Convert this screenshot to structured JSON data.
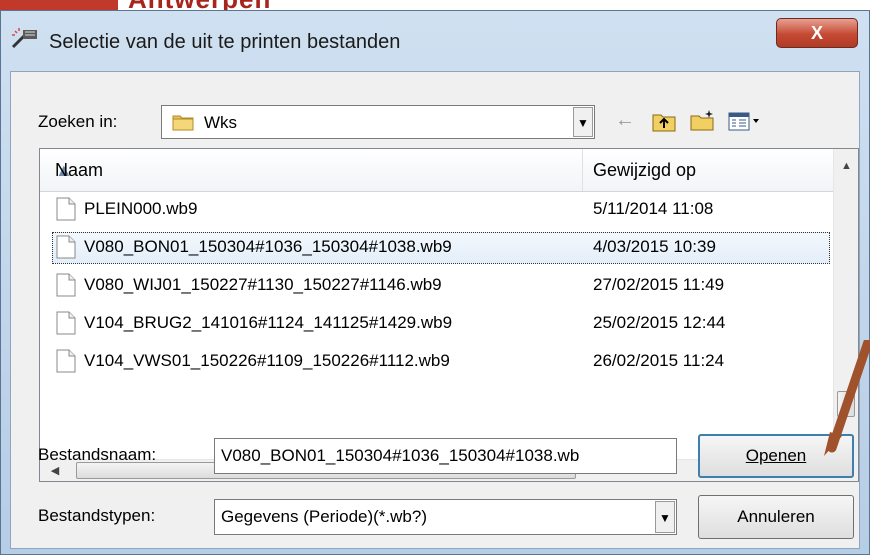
{
  "background_heading": "Antwerpen",
  "dialog": {
    "title": "Selectie van de uit te printen bestanden",
    "close_label": "X"
  },
  "lookin": {
    "label": "Zoeken in:",
    "value": "Wks"
  },
  "columns": {
    "name": "Naam",
    "date": "Gewijzigd op"
  },
  "files": [
    {
      "name": "PLEIN000.wb9",
      "date": "5/11/2014 11:08"
    },
    {
      "name": "V080_BON01_150304#1036_150304#1038.wb9",
      "date": "4/03/2015 10:39",
      "selected": true
    },
    {
      "name": "V080_WIJ01_150227#1130_150227#1146.wb9",
      "date": "27/02/2015 11:49"
    },
    {
      "name": "V104_BRUG2_141016#1124_141125#1429.wb9",
      "date": "25/02/2015 12:44"
    },
    {
      "name": "V104_VWS01_150226#1109_150226#1112.wb9",
      "date": "26/02/2015 11:24"
    }
  ],
  "hscroll_grip": "III",
  "filename": {
    "label": "Bestandsnaam:",
    "value": "V080_BON01_150304#1036_150304#1038.wb"
  },
  "filetype": {
    "label": "Bestandstypen:",
    "value": "Gegevens (Periode)(*.wb?)"
  },
  "buttons": {
    "open": "Openen",
    "cancel": "Annuleren"
  },
  "toolbar": {
    "back_glyph": "←"
  },
  "colors": {
    "accent_red": "#c0392b",
    "arrow_brown": "#a0522d",
    "title_bar": "#cfe0f1"
  },
  "icons": [
    "wand-icon",
    "folder-icon",
    "back-icon",
    "up-folder-icon",
    "new-folder-icon",
    "view-menu-icon",
    "file-icon"
  ]
}
